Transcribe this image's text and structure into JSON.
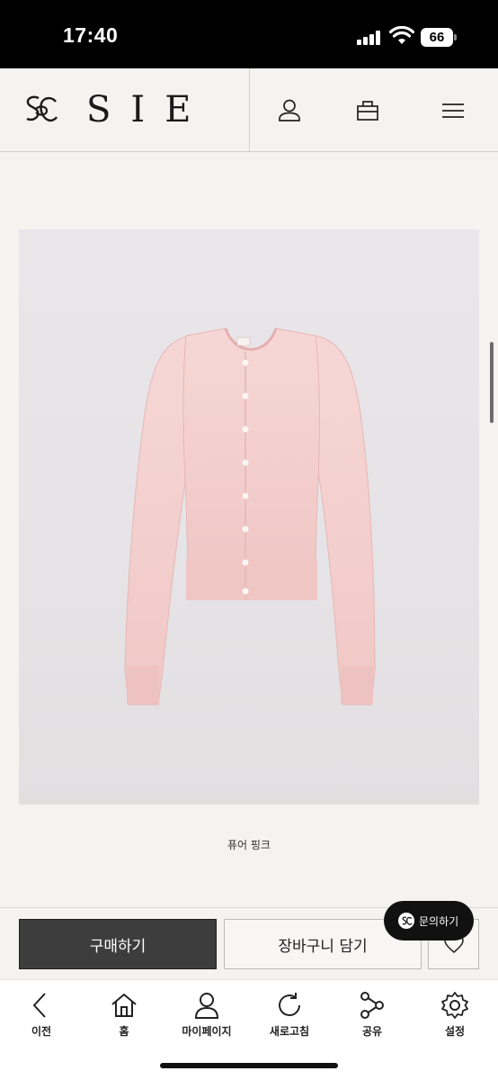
{
  "status_bar": {
    "time": "17:40",
    "battery": "66"
  },
  "header": {
    "logo_text": "SIE",
    "icons": [
      "user-icon",
      "shopping-bag-icon",
      "menu-icon"
    ]
  },
  "product": {
    "caption": "퓨어 핑크",
    "color": "#f3cfcf"
  },
  "actions": {
    "buy_label": "구매하기",
    "cart_label": "장바구니 담기",
    "inquiry_label": "문의하기"
  },
  "bottom_nav": {
    "items": [
      {
        "label": "이전",
        "icon": "back-arrow-icon"
      },
      {
        "label": "홈",
        "icon": "home-icon"
      },
      {
        "label": "마이페이지",
        "icon": "user-icon"
      },
      {
        "label": "새로고침",
        "icon": "refresh-icon"
      },
      {
        "label": "공유",
        "icon": "share-icon"
      },
      {
        "label": "설정",
        "icon": "gear-icon"
      }
    ]
  }
}
